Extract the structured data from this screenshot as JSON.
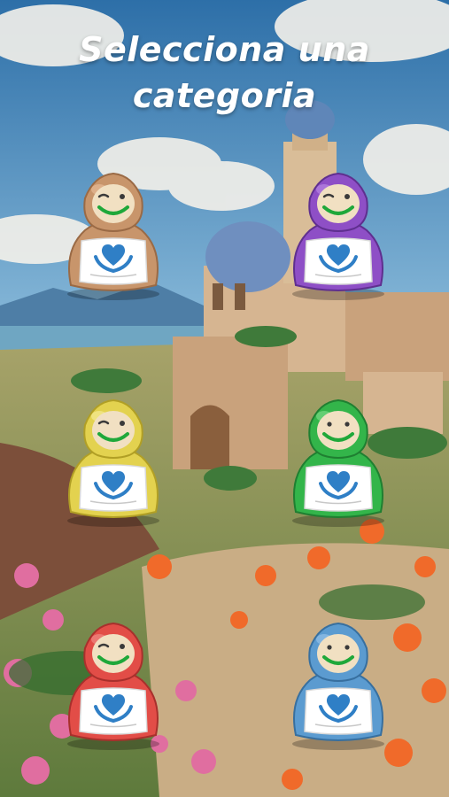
{
  "screen": {
    "title_line1": "Selecciona una",
    "title_line2": "categoria"
  },
  "categories": [
    {
      "id": "brown",
      "color": "#c8956b",
      "dark": "#9a6a45",
      "light": "#e6bb95",
      "icon": "heart-in-hands-icon",
      "expression": "wink"
    },
    {
      "id": "purple",
      "color": "#8e4fc6",
      "dark": "#5f2f8f",
      "light": "#b886e3",
      "icon": "heart-in-hands-icon",
      "expression": "wink"
    },
    {
      "id": "yellow",
      "color": "#e3d24f",
      "dark": "#b19f25",
      "light": "#f4ea95",
      "icon": "heart-in-hands-icon",
      "expression": "wink"
    },
    {
      "id": "green",
      "color": "#33b54a",
      "dark": "#1f7f31",
      "light": "#79d985",
      "icon": "heart-in-hands-icon",
      "expression": "smile"
    },
    {
      "id": "red",
      "color": "#e24d47",
      "dark": "#a8302c",
      "light": "#f08a84",
      "icon": "heart-in-hands-icon",
      "expression": "wink"
    },
    {
      "id": "blue",
      "color": "#5b9bd0",
      "dark": "#376f9f",
      "light": "#93c1e8",
      "icon": "heart-in-hands-icon",
      "expression": "smile"
    }
  ],
  "colors": {
    "face": "#f1e0c2",
    "mouth": "#1fa83a",
    "apron": "#ffffff",
    "heart_icon": "#2f7fc6"
  }
}
